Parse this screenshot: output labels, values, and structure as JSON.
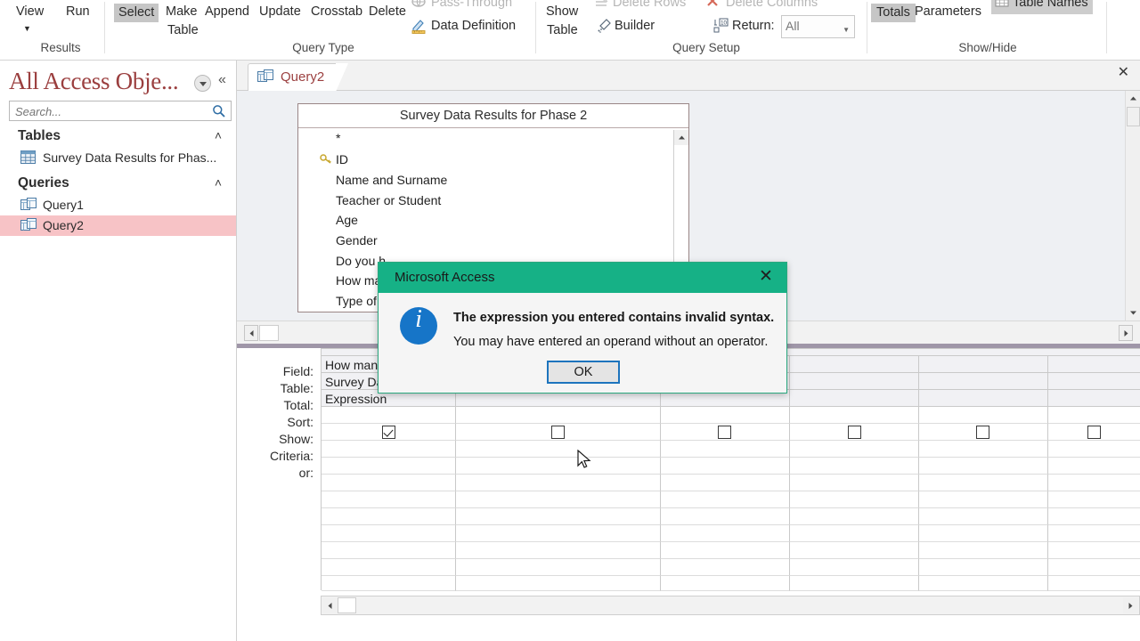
{
  "ribbon": {
    "groups": [
      {
        "label": "Results"
      },
      {
        "label": "Query Type"
      },
      {
        "label": "Query Setup"
      },
      {
        "label": "Show/Hide"
      }
    ],
    "results": {
      "view": "View",
      "run": "Run"
    },
    "query_type": {
      "select": "Select",
      "make_table_line1": "Make",
      "make_table_line2": "Table",
      "append": "Append",
      "update": "Update",
      "crosstab": "Crosstab",
      "delete": "Delete",
      "pass_through": "Pass-Through",
      "data_definition": "Data Definition"
    },
    "query_setup": {
      "show_table_line1": "Show",
      "show_table_line2": "Table",
      "delete_rows": "Delete Rows",
      "builder": "Builder",
      "delete_columns": "Delete Columns",
      "return_label": "Return:",
      "return_value": "All"
    },
    "show_hide": {
      "totals": "Totals",
      "parameters": "Parameters",
      "table_names": "Table Names"
    },
    "collapse_glyph": "˄"
  },
  "navpane": {
    "title": "All Access Obje...",
    "collapse_glyph": "«",
    "search": {
      "value": "",
      "placeholder": "Search..."
    },
    "groups": [
      {
        "label": "Tables",
        "chevron": "˄",
        "items": [
          {
            "label": "Survey Data Results for Phas...",
            "selected": false
          }
        ]
      },
      {
        "label": "Queries",
        "chevron": "˄",
        "items": [
          {
            "label": "Query1",
            "selected": false
          },
          {
            "label": "Query2",
            "selected": true
          }
        ]
      }
    ]
  },
  "document_tab": {
    "label": "Query2",
    "close_glyph": "✕"
  },
  "query_design": {
    "table_box": {
      "title": "Survey Data Results for Phase 2",
      "fields": [
        {
          "name": "*",
          "key": false
        },
        {
          "name": "ID",
          "key": true
        },
        {
          "name": "Name and Surname",
          "key": false
        },
        {
          "name": "Teacher or Student",
          "key": false
        },
        {
          "name": "Age",
          "key": false
        },
        {
          "name": "Gender",
          "key": false
        },
        {
          "name": "Do you h",
          "key": false
        },
        {
          "name": "How ma",
          "key": false
        },
        {
          "name": "Type of",
          "key": false
        }
      ]
    },
    "grid": {
      "row_headers": [
        "Field:",
        "Table:",
        "Total:",
        "Sort:",
        "Show:",
        "Criteria:",
        "or:"
      ],
      "columns": [
        {
          "field": "How man",
          "table": "Survey Da",
          "total": "Expression",
          "sort": "",
          "show": true,
          "criteria": "",
          "or": ""
        },
        {
          "field": "",
          "table": "",
          "total": "",
          "sort": "",
          "show": false,
          "criteria": "",
          "or": ""
        },
        {
          "field": "",
          "table": "",
          "total": "",
          "sort": "",
          "show": false,
          "criteria": "",
          "or": ""
        },
        {
          "field": "",
          "table": "",
          "total": "",
          "sort": "",
          "show": false,
          "criteria": "",
          "or": ""
        },
        {
          "field": "",
          "table": "",
          "total": "",
          "sort": "",
          "show": false,
          "criteria": "",
          "or": ""
        }
      ]
    }
  },
  "dialog": {
    "title": "Microsoft Access",
    "close_glyph": "✕",
    "message_line1": "The expression you entered contains invalid syntax.",
    "message_line2": "You may have entered an operand without an operator.",
    "ok_label": "OK",
    "title_color": "#16b186",
    "info_icon_color": "#1675c8"
  }
}
